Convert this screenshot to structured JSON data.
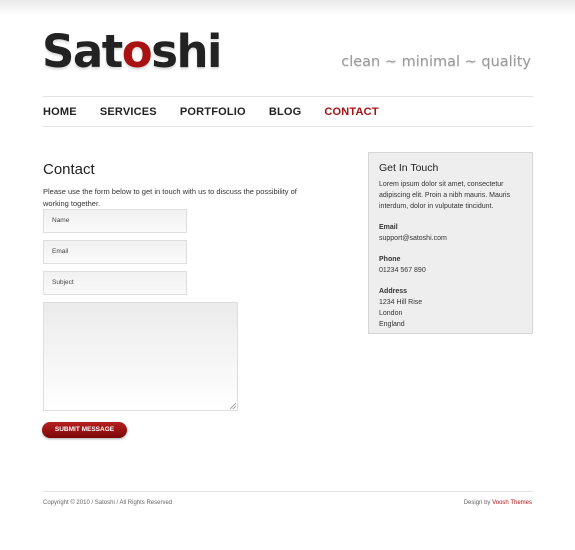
{
  "logo": {
    "part1": "Sat",
    "accent": "o",
    "part2": "shi"
  },
  "tagline": "clean ~ minimal ~ quality",
  "nav": [
    {
      "label": "HOME"
    },
    {
      "label": "SERVICES"
    },
    {
      "label": "PORTFOLIO"
    },
    {
      "label": "BLOG"
    },
    {
      "label": "CONTACT",
      "active": true
    }
  ],
  "contact": {
    "title": "Contact",
    "intro": "Please use the form below to get in touch with us to discuss the possibility of working together.",
    "fields": {
      "name": "Name",
      "email": "Email",
      "subject": "Subject"
    },
    "submit": "SUBMIT MESSAGE"
  },
  "sidebar": {
    "title": "Get In Touch",
    "text": "Lorem ipsum dolor sit amet, consectetur adipiscing elit. Proin a nibh mauris. Mauris interdum, dolor in vulputate tincidunt.",
    "email_label": "Email",
    "email": "support@satoshi.com",
    "phone_label": "Phone",
    "phone": "01234 567 890",
    "address_label": "Address",
    "address": [
      "1234 Hill Rise",
      "London",
      "England"
    ]
  },
  "footer": {
    "copyright": "Copyright © 2010 / Satoshi / All Rights Reserved",
    "design_prefix": "Design by",
    "design_credit": "Voosh Themes"
  },
  "colors": {
    "accent": "#a81212",
    "sidebar_bg": "#eeeeee"
  }
}
